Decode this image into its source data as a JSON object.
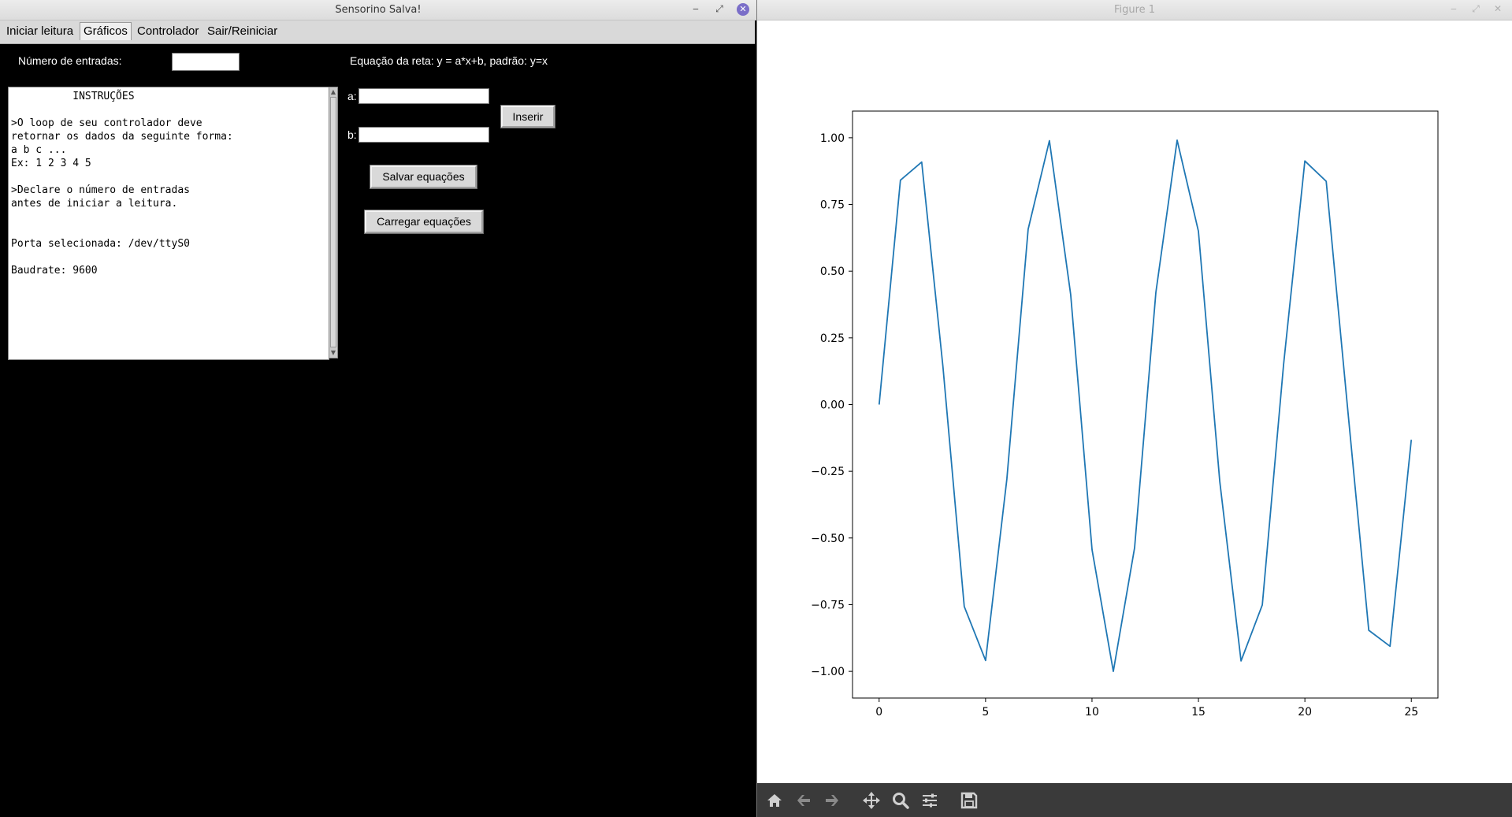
{
  "left_window": {
    "title": "Sensorino Salva!",
    "controls": {
      "minimize": "‒",
      "restore": "⤢",
      "close": "✕"
    },
    "menu": [
      "Iniciar leitura",
      "Gráficos",
      "Controlador",
      "Sair/Reiniciar"
    ],
    "active_menu": "Gráficos",
    "entries_label": "Número de entradas:",
    "entries_value": "",
    "equation_label": "Equação da reta: y = a*x+b, padrão: y=x",
    "a_label": "a:",
    "a_value": "",
    "b_label": "b:",
    "b_value": "",
    "insert_button": "Inserir",
    "save_button": "Salvar equações",
    "load_button": "Carregar equações",
    "instructions": "          INSTRUÇÕES\n\n>O loop de seu controlador deve\nretornar os dados da seguinte forma:\na b c ...\nEx: 1 2 3 4 5\n\n>Declare o número de entradas\nantes de iniciar a leitura.\n\n\nPorta selecionada: /dev/ttyS0\n\nBaudrate: 9600"
  },
  "right_window": {
    "title": "Figure 1",
    "controls": {
      "minimize": "‒",
      "restore": "⤢",
      "close": "✕"
    },
    "toolbar_icons": [
      "home-icon",
      "back-icon",
      "forward-icon",
      "pan-icon",
      "zoom-icon",
      "configure-subplots-icon",
      "save-icon"
    ]
  },
  "chart_data": {
    "type": "line",
    "x": [
      0,
      1,
      2,
      3,
      4,
      5,
      6,
      7,
      8,
      9,
      10,
      11,
      12,
      13,
      14,
      15,
      16,
      17,
      18,
      19,
      20,
      21,
      22,
      23,
      24,
      25
    ],
    "series": [
      {
        "color": "#1f77b4",
        "values": [
          0.0,
          0.841,
          0.909,
          0.141,
          -0.757,
          -0.959,
          -0.279,
          0.657,
          0.989,
          0.412,
          -0.544,
          -1.0,
          -0.537,
          0.42,
          0.991,
          0.65,
          -0.288,
          -0.961,
          -0.751,
          0.15,
          0.913,
          0.837,
          -0.009,
          -0.846,
          -0.906,
          -0.132
        ]
      }
    ],
    "xticks": [
      0,
      5,
      10,
      15,
      20,
      25
    ],
    "yticks": [
      1.0,
      0.75,
      0.5,
      0.25,
      0.0,
      -0.25,
      -0.5,
      -0.75,
      -1.0
    ],
    "ytick_labels": [
      "1.00",
      "0.75",
      "0.50",
      "0.25",
      "0.00",
      "−0.25",
      "−0.50",
      "−0.75",
      "−1.00"
    ],
    "xlim": [
      -1.25,
      26.25
    ],
    "ylim": [
      -1.1,
      1.1
    ],
    "grid": false,
    "title": "",
    "xlabel": "",
    "ylabel": ""
  }
}
